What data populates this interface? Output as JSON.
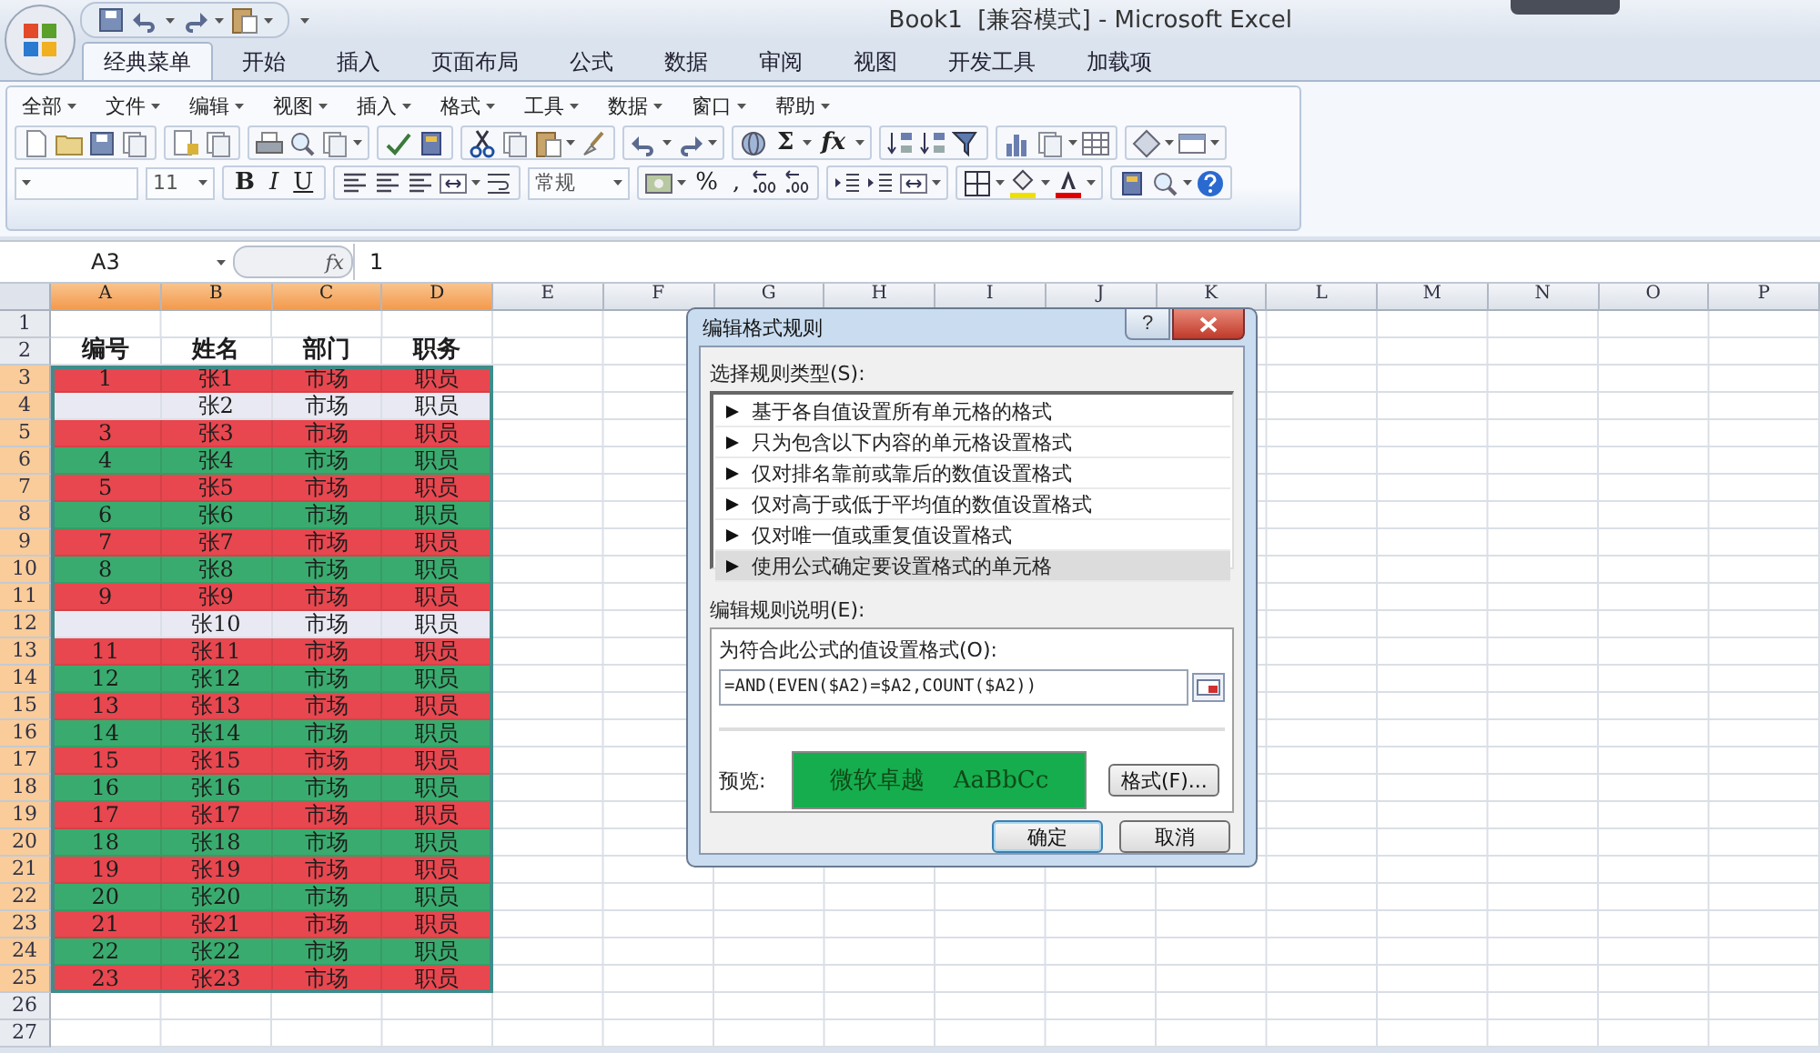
{
  "title_bar": {
    "title": "Book1  [兼容模式] - Microsoft Excel"
  },
  "tabs": [
    {
      "label": "经典菜单",
      "selected": true
    },
    {
      "label": "开始",
      "selected": false
    },
    {
      "label": "插入",
      "selected": false
    },
    {
      "label": "页面布局",
      "selected": false
    },
    {
      "label": "公式",
      "selected": false
    },
    {
      "label": "数据",
      "selected": false
    },
    {
      "label": "审阅",
      "selected": false
    },
    {
      "label": "视图",
      "selected": false
    },
    {
      "label": "开发工具",
      "selected": false
    },
    {
      "label": "加载项",
      "selected": false
    }
  ],
  "menu": [
    "全部",
    "文件",
    "编辑",
    "视图",
    "插入",
    "格式",
    "工具",
    "数据",
    "窗口",
    "帮助"
  ],
  "toolbar": {
    "sum": "Σ",
    "function": "fx",
    "font_size": "11",
    "bold": "B",
    "italic": "I",
    "underline": "U",
    "number_format": "常规",
    "percent": "%",
    "comma": ","
  },
  "formula_bar": {
    "name_box": "A3",
    "function_label": "fx",
    "value": "1"
  },
  "sheet": {
    "columns": [
      {
        "label": "A",
        "selected": true
      },
      {
        "label": "B",
        "selected": true
      },
      {
        "label": "C",
        "selected": true
      },
      {
        "label": "D",
        "selected": true
      },
      {
        "label": "E",
        "selected": false
      },
      {
        "label": "F",
        "selected": false
      },
      {
        "label": "G",
        "selected": false
      },
      {
        "label": "H",
        "selected": false
      },
      {
        "label": "I",
        "selected": false
      },
      {
        "label": "J",
        "selected": false
      },
      {
        "label": "K",
        "selected": false
      },
      {
        "label": "L",
        "selected": false
      },
      {
        "label": "M",
        "selected": false
      },
      {
        "label": "N",
        "selected": false
      },
      {
        "label": "O",
        "selected": false
      },
      {
        "label": "P",
        "selected": false
      }
    ],
    "rows": [
      {
        "label": "1",
        "kind": "empty",
        "selected": false
      },
      {
        "label": "2",
        "kind": "header",
        "selected": false,
        "cells": [
          "编号",
          "姓名",
          "部门",
          "职务"
        ]
      },
      {
        "label": "3",
        "kind": "data",
        "selected": true,
        "color": "#e8474f",
        "cells": [
          "1",
          "张1",
          "市场",
          "职员"
        ]
      },
      {
        "label": "4",
        "kind": "data",
        "selected": true,
        "cells": [
          null,
          "张2",
          "市场",
          "职员"
        ]
      },
      {
        "label": "5",
        "kind": "data",
        "selected": true,
        "color": "#e8474f",
        "cells": [
          "3",
          "张3",
          "市场",
          "职员"
        ]
      },
      {
        "label": "6",
        "kind": "data",
        "selected": true,
        "color": "#3aab6e",
        "cells": [
          "4",
          "张4",
          "市场",
          "职员"
        ]
      },
      {
        "label": "7",
        "kind": "data",
        "selected": true,
        "color": "#e8474f",
        "cells": [
          "5",
          "张5",
          "市场",
          "职员"
        ]
      },
      {
        "label": "8",
        "kind": "data",
        "selected": true,
        "color": "#3aab6e",
        "cells": [
          "6",
          "张6",
          "市场",
          "职员"
        ]
      },
      {
        "label": "9",
        "kind": "data",
        "selected": true,
        "color": "#e8474f",
        "cells": [
          "7",
          "张7",
          "市场",
          "职员"
        ]
      },
      {
        "label": "10",
        "kind": "data",
        "selected": true,
        "color": "#3aab6e",
        "cells": [
          "8",
          "张8",
          "市场",
          "职员"
        ]
      },
      {
        "label": "11",
        "kind": "data",
        "selected": true,
        "color": "#e8474f",
        "cells": [
          "9",
          "张9",
          "市场",
          "职员"
        ]
      },
      {
        "label": "12",
        "kind": "data",
        "selected": true,
        "cells": [
          null,
          "张10",
          "市场",
          "职员"
        ]
      },
      {
        "label": "13",
        "kind": "data",
        "selected": true,
        "color": "#e8474f",
        "cells": [
          "11",
          "张11",
          "市场",
          "职员"
        ]
      },
      {
        "label": "14",
        "kind": "data",
        "selected": true,
        "color": "#3aab6e",
        "cells": [
          "12",
          "张12",
          "市场",
          "职员"
        ]
      },
      {
        "label": "15",
        "kind": "data",
        "selected": true,
        "color": "#e8474f",
        "cells": [
          "13",
          "张13",
          "市场",
          "职员"
        ]
      },
      {
        "label": "16",
        "kind": "data",
        "selected": true,
        "color": "#3aab6e",
        "cells": [
          "14",
          "张14",
          "市场",
          "职员"
        ]
      },
      {
        "label": "17",
        "kind": "data",
        "selected": true,
        "color": "#e8474f",
        "cells": [
          "15",
          "张15",
          "市场",
          "职员"
        ]
      },
      {
        "label": "18",
        "kind": "data",
        "selected": true,
        "color": "#3aab6e",
        "cells": [
          "16",
          "张16",
          "市场",
          "职员"
        ]
      },
      {
        "label": "19",
        "kind": "data",
        "selected": true,
        "color": "#e8474f",
        "cells": [
          "17",
          "张17",
          "市场",
          "职员"
        ]
      },
      {
        "label": "20",
        "kind": "data",
        "selected": true,
        "color": "#3aab6e",
        "cells": [
          "18",
          "张18",
          "市场",
          "职员"
        ]
      },
      {
        "label": "21",
        "kind": "data",
        "selected": true,
        "color": "#e8474f",
        "cells": [
          "19",
          "张19",
          "市场",
          "职员"
        ]
      },
      {
        "label": "22",
        "kind": "data",
        "selected": true,
        "color": "#3aab6e",
        "cells": [
          "20",
          "张20",
          "市场",
          "职员"
        ]
      },
      {
        "label": "23",
        "kind": "data",
        "selected": true,
        "color": "#e8474f",
        "cells": [
          "21",
          "张21",
          "市场",
          "职员"
        ]
      },
      {
        "label": "24",
        "kind": "data",
        "selected": true,
        "color": "#3aab6e",
        "cells": [
          "22",
          "张22",
          "市场",
          "职员"
        ]
      },
      {
        "label": "25",
        "kind": "data",
        "selected": true,
        "color": "#e8474f",
        "cells": [
          "23",
          "张23",
          "市场",
          "职员"
        ]
      },
      {
        "label": "26",
        "kind": "empty",
        "selected": false
      },
      {
        "label": "27",
        "kind": "empty",
        "selected": false
      }
    ]
  },
  "dialog": {
    "title": "编辑格式规则",
    "help_label": "?",
    "rule_type_label": "选择规则类型(S):",
    "rule_types": [
      {
        "label": "基于各自值设置所有单元格的格式",
        "selected": false
      },
      {
        "label": "只为包含以下内容的单元格设置格式",
        "selected": false
      },
      {
        "label": "仅对排名靠前或靠后的数值设置格式",
        "selected": false
      },
      {
        "label": "仅对高于或低于平均值的数值设置格式",
        "selected": false
      },
      {
        "label": "仅对唯一值或重复值设置格式",
        "selected": false
      },
      {
        "label": "使用公式确定要设置格式的单元格",
        "selected": true
      }
    ],
    "description_label": "编辑规则说明(E):",
    "formula_label": "为符合此公式的值设置格式(O):",
    "formula": "=AND(EVEN($A2)=$A2,COUNT($A2))",
    "preview_label": "预览:",
    "preview_text": [
      "微软卓越",
      "AaBbCc"
    ],
    "format_button": "格式(F)...",
    "ok_button": "确定",
    "cancel_button": "取消"
  }
}
